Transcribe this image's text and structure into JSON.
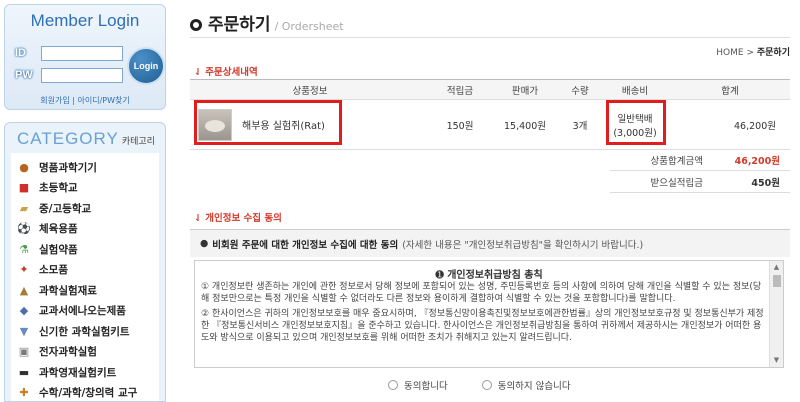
{
  "sidebar": {
    "login": {
      "title": "Member Login",
      "id_label": "ID",
      "pw_label": "PW",
      "button": "Login",
      "links": "회원가입 | 아이디/PW찾기"
    },
    "category": {
      "title": "CATEGORY",
      "subtitle": "카테고리",
      "items": [
        {
          "label": "명품과학기기",
          "icon": "globe-icon"
        },
        {
          "label": "초등학교",
          "icon": "school-icon"
        },
        {
          "label": "중/고등학교",
          "icon": "book-icon"
        },
        {
          "label": "체육용품",
          "icon": "ball-icon"
        },
        {
          "label": "실험약품",
          "icon": "flask-icon"
        },
        {
          "label": "소모품",
          "icon": "tool-icon"
        },
        {
          "label": "과학실험재료",
          "icon": "material-icon"
        },
        {
          "label": "교과서에나오는제품",
          "icon": "textbook-icon"
        },
        {
          "label": "신기한 과학실험키트",
          "icon": "kit-icon"
        },
        {
          "label": "전자과학실험",
          "icon": "electronics-icon"
        },
        {
          "label": "과학영재실험키트",
          "icon": "gifted-kit-icon"
        },
        {
          "label": "수학/과학/창의력 교구",
          "icon": "math-icon"
        }
      ]
    }
  },
  "main": {
    "title": "주문하기",
    "title_en": "/ Ordersheet",
    "breadcrumb_home": "HOME",
    "breadcrumb_sep": ">",
    "breadcrumb_current": "주문하기",
    "order_section_title": "주문상세내역",
    "table": {
      "headers": [
        "상품정보",
        "적립금",
        "판매가",
        "수량",
        "배송비",
        "합계"
      ],
      "rows": [
        {
          "product": "해부용 실험쥐(Rat)",
          "points": "150원",
          "price": "15,400원",
          "qty": "3개",
          "shipping_line1": "일반택배",
          "shipping_line2": "(3,000원)",
          "total": "46,200원"
        }
      ]
    },
    "summary": {
      "total_label": "상품합계금액",
      "total_value": "46,200원",
      "points_label": "받으실적립금",
      "points_value": "450원"
    },
    "privacy_section_title": "개인정보 수집 동의",
    "privacy_notice_bold": "비회원 주문에 대한 개인정보 수집에 대한 동의",
    "privacy_notice_gray": "(자세한 내용은 \"개인정보취급방침\"을 확인하시기 바랍니다.)",
    "terms": {
      "heading": "개인정보취급방침 총칙",
      "para1": "① 개인정보란 생존하는 개인에 관한 정보로서 당해 정보에 포함되어 있는 성명, 주민등록번호 등의 사항에 의하여 당해 개인을 식별할 수 있는 정보(당해 정보만으로는 특정 개인을 식별할 수 없더라도 다른 정보와 용이하게 결합하여 식별할 수 있는 것을 포함합니다)를 말합니다.",
      "para2": "② 한사이언스은 귀하의 개인정보보호를 매우 중요시하며, 『정보통신망이용촉진및정보보호에관한법률』상의 개인정보보호규정 및 정보통신부가 제정한 『정보통신서비스 개인정보보호지침』을 준수하고 있습니다. 한사이언스은 개인정보취급방침을 통하여 귀하께서 제공하시는 개인정보가 어떠한 용도와 방식으로 이용되고 있으며 개인정보보호를 위해 어떠한 조치가 취해지고 있는지 알려드립니다."
    },
    "agree_label": "동의합니다",
    "disagree_label": "동의하지 않습니다"
  },
  "colors": {
    "accent_red": "#d03a2a",
    "highlight_box": "#e01e1e",
    "login_blue": "#2f6fb5"
  }
}
